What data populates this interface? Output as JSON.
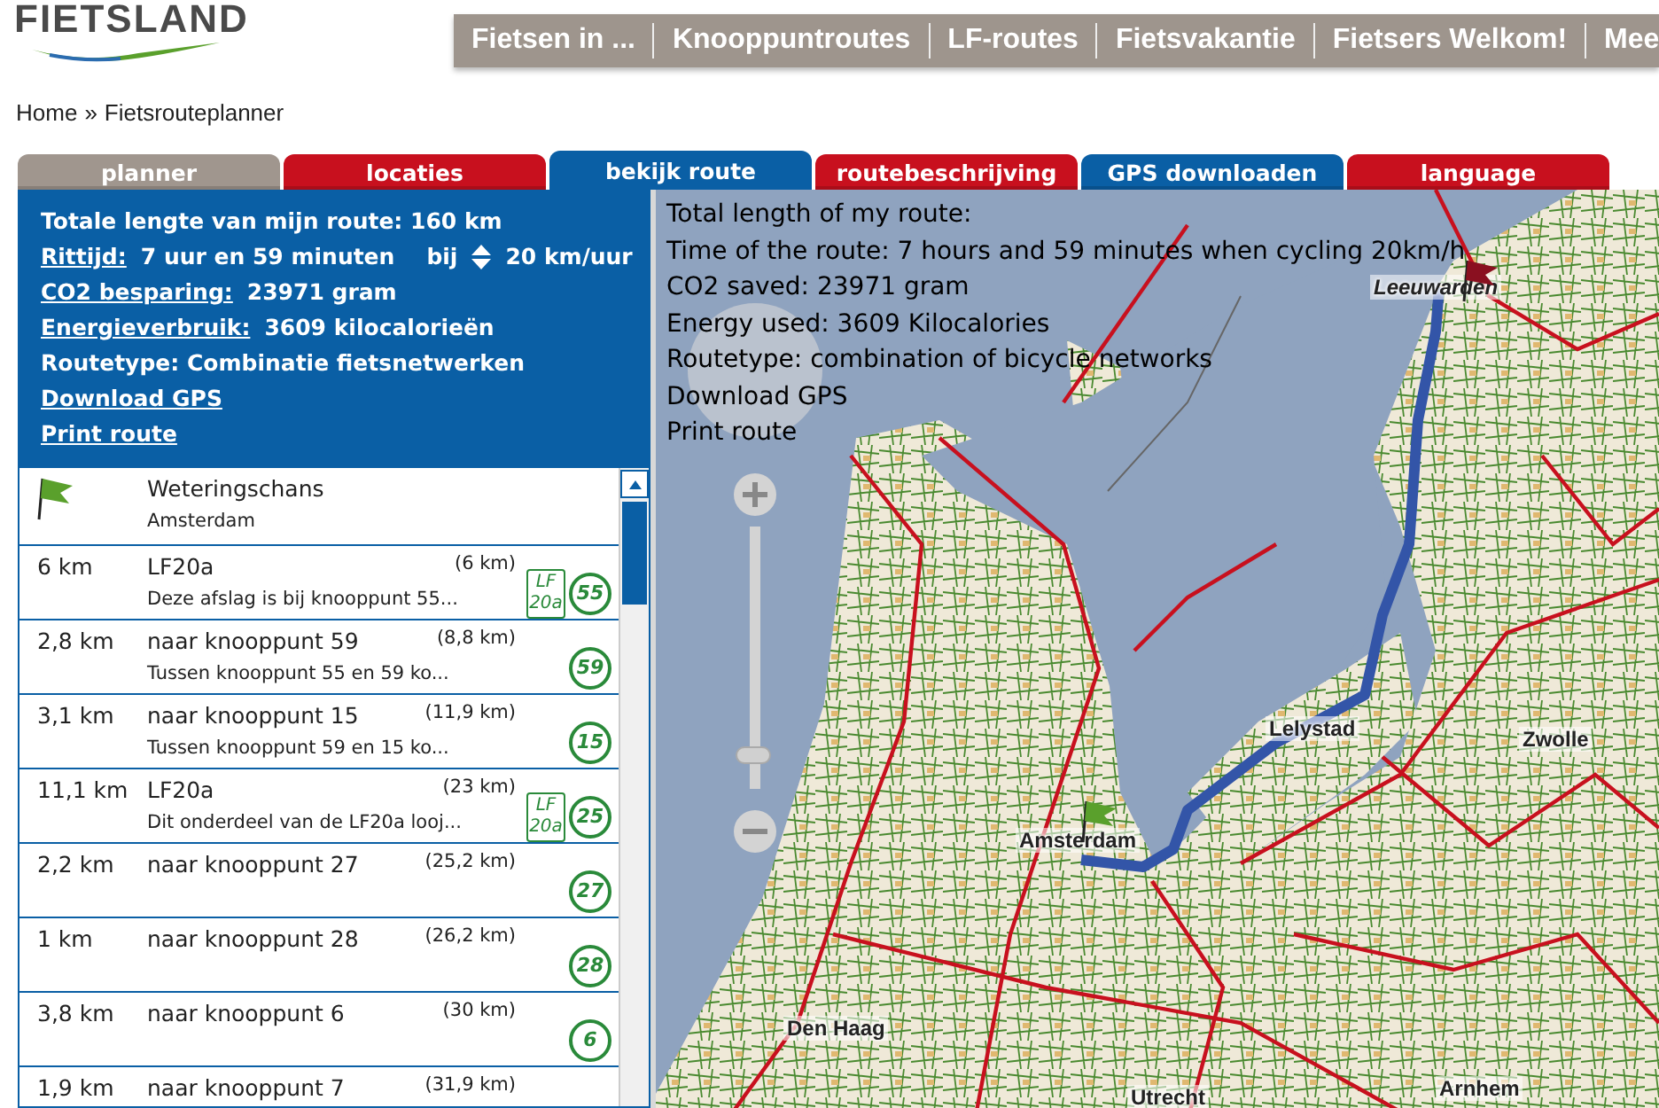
{
  "logo": {
    "text": "FIETSLAND"
  },
  "nav": [
    "Fietsen in ...",
    "Knooppuntroutes",
    "LF-routes",
    "Fietsvakantie",
    "Fietsers Welkom!",
    "Mee"
  ],
  "breadcrumb": {
    "home": "Home",
    "separator": "»",
    "current": "Fietsrouteplanner"
  },
  "tabs": [
    {
      "label": "planner",
      "selected": false,
      "color": "#a0968e"
    },
    {
      "label": "locaties",
      "selected": false,
      "color": "#c8101e"
    },
    {
      "label": "bekijk route",
      "selected": true,
      "color": "#0a5fa5"
    },
    {
      "label": "routebeschrijving",
      "selected": false,
      "color": "#c8101e"
    },
    {
      "label": "GPS downloaden",
      "selected": false,
      "color": "#0a5fa5"
    },
    {
      "label": "language",
      "selected": false,
      "color": "#c8101e"
    }
  ],
  "summary": {
    "total": "Totale lengte van mijn route: 160 km",
    "duration": {
      "label": "Rittijd:",
      "value": "7 uur en 59 minuten",
      "speed_prefix": "bij",
      "speed": "20 km/uur"
    },
    "co2": {
      "label": "CO2 besparing:",
      "value": "23971 gram"
    },
    "energy": {
      "label": "Energieverbruik:",
      "value": "3609 kilocalorieën"
    },
    "routetype": "Routetype: Combinatie fietsnetwerken",
    "links": [
      "Download GPS",
      "Print route"
    ]
  },
  "steps": [
    {
      "kind": "start",
      "name": "Weteringschans",
      "detail": "Amsterdam"
    },
    {
      "kind": "leg",
      "distance": "6 km",
      "name": "LF20a",
      "total": "(6 km)",
      "detail": "Deze afslag is bij knooppunt 55...",
      "lf": {
        "top": "LF",
        "bottom": "20a"
      },
      "node": "55"
    },
    {
      "kind": "leg",
      "distance": "2,8 km",
      "name": "naar knooppunt 59",
      "total": "(8,8 km)",
      "detail": "Tussen knooppunt 55 en 59 ko...",
      "node": "59"
    },
    {
      "kind": "leg",
      "distance": "3,1 km",
      "name": "naar knooppunt 15",
      "total": "(11,9 km)",
      "detail": "Tussen knooppunt 59 en 15 ko...",
      "node": "15"
    },
    {
      "kind": "leg",
      "distance": "11,1 km",
      "name": "LF20a",
      "total": "(23 km)",
      "detail": "Dit onderdeel van de LF20a looj...",
      "lf": {
        "top": "LF",
        "bottom": "20a"
      },
      "node": "25"
    },
    {
      "kind": "leg",
      "distance": "2,2 km",
      "name": "naar knooppunt 27",
      "total": "(25,2 km)",
      "node": "27"
    },
    {
      "kind": "leg",
      "distance": "1 km",
      "name": "naar knooppunt 28",
      "total": "(26,2 km)",
      "node": "28"
    },
    {
      "kind": "leg",
      "distance": "3,8 km",
      "name": "naar knooppunt 6",
      "total": "(30 km)",
      "node": "6"
    },
    {
      "kind": "leg",
      "distance": "1,9 km",
      "name": "naar knooppunt 7",
      "total": "(31,9 km)"
    }
  ],
  "map": {
    "overlay": [
      "Total length of my route:",
      "Time of the route: 7 hours and 59 minutes when cycling 20km/h",
      "CO2 saved: 23971 gram",
      "Energy used: 3609 Kilocalories",
      "Routetype: combination of bicycle networks",
      "Download GPS",
      "Print route"
    ],
    "cities": [
      "Leeuwarden",
      "Lelystad",
      "Zwolle",
      "Amsterdam",
      "Den Haag",
      "Utrecht",
      "Arnhem"
    ],
    "zoom": {
      "level": 0.1
    }
  }
}
